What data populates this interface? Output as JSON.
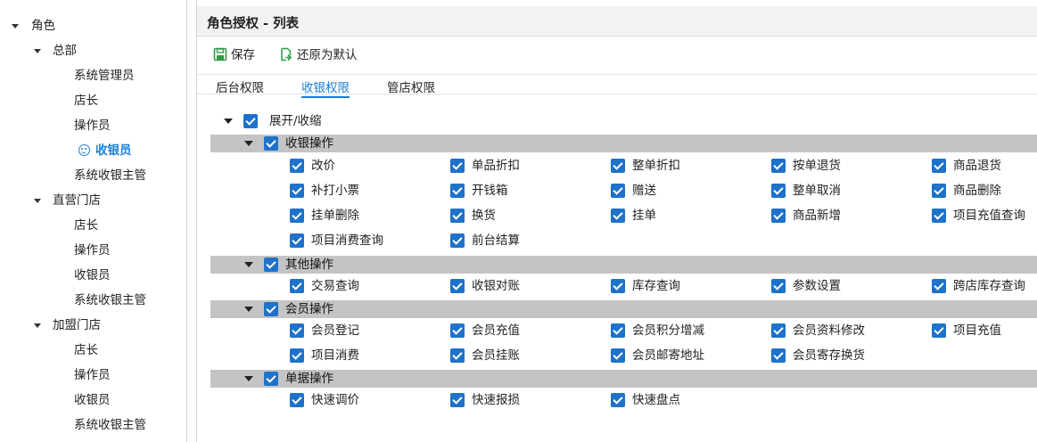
{
  "tree": {
    "root": "角色",
    "groups": [
      {
        "label": "总部",
        "children": [
          "系统管理员",
          "店长",
          "操作员",
          "收银员",
          "系统收银主管"
        ]
      },
      {
        "label": "直营门店",
        "children": [
          "店长",
          "操作员",
          "收银员",
          "系统收银主管"
        ]
      },
      {
        "label": "加盟门店",
        "children": [
          "店长",
          "操作员",
          "收银员",
          "系统收银主管"
        ]
      }
    ],
    "selected": "总部/收银员"
  },
  "header": {
    "title": "角色授权 - 列表"
  },
  "toolbar": {
    "save": "保存",
    "restore": "还原为默认"
  },
  "tabs": [
    "后台权限",
    "收银权限",
    "管店权限"
  ],
  "active_tab": "收银权限",
  "expand_all": "展开/收缩",
  "groups": [
    {
      "label": "收银操作",
      "items": [
        "改价",
        "单品折扣",
        "整单折扣",
        "按单退货",
        "商品退货",
        "补打小票",
        "开钱箱",
        "赠送",
        "整单取消",
        "商品删除",
        "挂单删除",
        "换货",
        "挂单",
        "商品新增",
        "项目充值查询",
        "项目消费查询",
        "前台结算"
      ]
    },
    {
      "label": "其他操作",
      "items": [
        "交易查询",
        "收银对账",
        "库存查询",
        "参数设置",
        "跨店库存查询"
      ]
    },
    {
      "label": "会员操作",
      "items": [
        "会员登记",
        "会员充值",
        "会员积分增减",
        "会员资料修改",
        "项目充值",
        "项目消费",
        "会员挂账",
        "会员邮寄地址",
        "会员寄存换货"
      ]
    },
    {
      "label": "单据操作",
      "items": [
        "快速调价",
        "快速报损",
        "快速盘点"
      ]
    }
  ],
  "colors": {
    "accent": "#1a7fd6",
    "checkbox": "#1f72c9",
    "group_bar": "#c4c4c4",
    "header_bg": "#f2f2f2",
    "save_icon": "#2f9a45"
  },
  "icons": {
    "save": "save-icon",
    "restore": "restore-icon",
    "selected_node": "smile-icon"
  }
}
